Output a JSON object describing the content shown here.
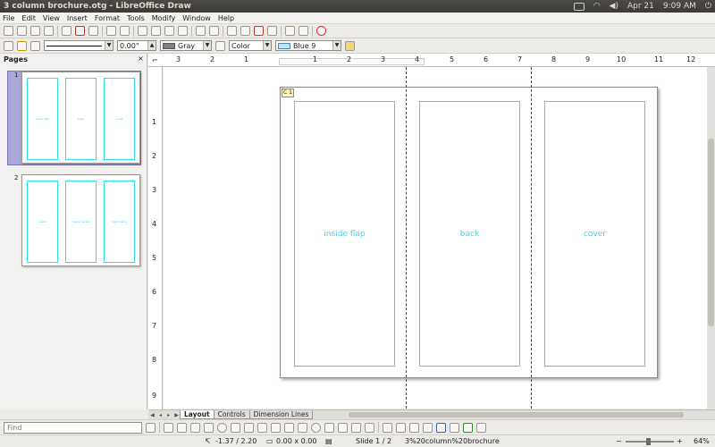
{
  "window": {
    "title": "3 column brochure.otg - LibreOffice Draw",
    "date": "Apr 21",
    "time": "9:09 AM"
  },
  "menu": [
    "File",
    "Edit",
    "View",
    "Insert",
    "Format",
    "Tools",
    "Modify",
    "Window",
    "Help"
  ],
  "toolbar2": {
    "angle": "0.00\"",
    "line_color": "Gray",
    "area_style": "Color",
    "area_color": "Blue 9",
    "gray_hex": "#808080",
    "blue9_hex": "#c5e3f7"
  },
  "pages_panel": {
    "title": "Pages",
    "close": "×",
    "thumbs": [
      {
        "num": "1",
        "labels": [
          "inside flap",
          "back",
          "cover"
        ]
      },
      {
        "num": "2",
        "labels": [
          "inside",
          "inside center",
          "right inside"
        ]
      }
    ]
  },
  "hruler": [
    "3",
    "2",
    "1",
    "1",
    "2",
    "3",
    "4",
    "5",
    "6",
    "7",
    "8",
    "9",
    "10",
    "11",
    "12"
  ],
  "vruler": [
    "1",
    "2",
    "3",
    "4",
    "5",
    "6",
    "7",
    "8",
    "9"
  ],
  "canvas": {
    "badge": "C 1",
    "columns": [
      "inside flap",
      "back",
      "cover"
    ],
    "accent": "#2de0e8"
  },
  "tabs": [
    "Layout",
    "Controls",
    "Dimension Lines"
  ],
  "find": {
    "placeholder": "Find"
  },
  "status": {
    "position": "-1.37 / 2.20",
    "size": "0.00 x 0.00",
    "slide": "Slide 1 / 2",
    "master": "3%20column%20brochure",
    "zoom": "64%"
  }
}
